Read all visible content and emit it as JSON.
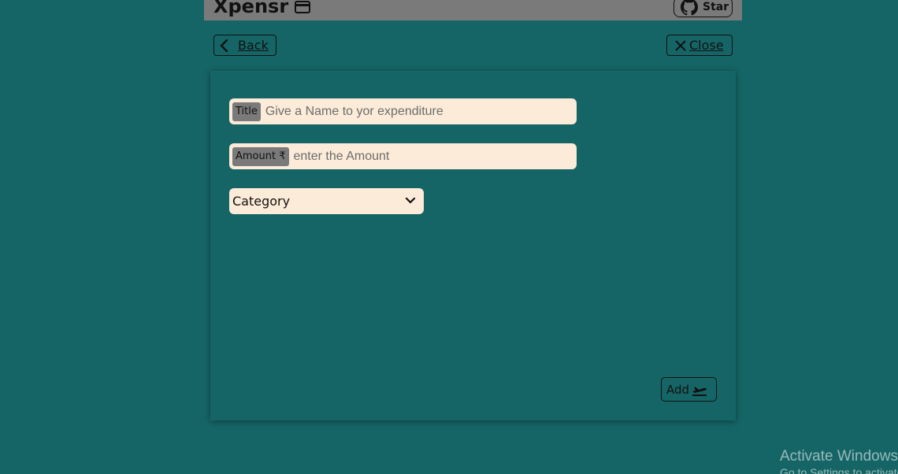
{
  "header": {
    "brand": "Xpensr",
    "brand_icon": "credit-card-icon",
    "star_label": "Star",
    "star_icon": "github-icon"
  },
  "nav": {
    "back_label": "Back",
    "close_label": "Close"
  },
  "form": {
    "title_tag": "Title",
    "title_placeholder": "Give a Name to yor expenditure",
    "amount_tag": "Amount ₹",
    "amount_placeholder": "enter the Amount",
    "category_value": "Category",
    "add_label": "Add"
  },
  "watermark": {
    "line1": "Activate Windows",
    "line2": "Go to Settings to activate Windows."
  },
  "colors": {
    "background": "#166566",
    "header": "#7a7a7a",
    "field": "#fbebd8"
  }
}
